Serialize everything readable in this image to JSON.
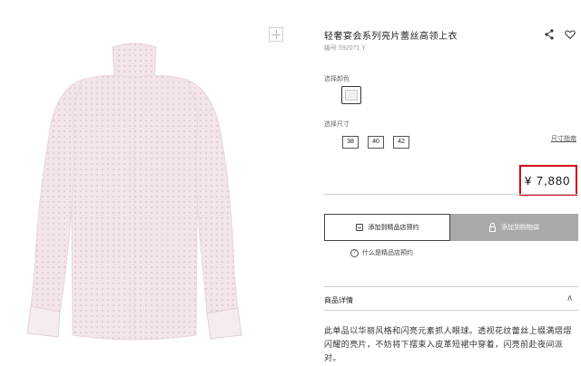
{
  "product": {
    "title": "轻奢宴会系列亮片蕾丝高领上衣",
    "sku": "编号 592071 Y",
    "image_icon": "blouse-product-image"
  },
  "icons": {
    "zoom": "plus-icon",
    "share": "share-icon",
    "favorite": "heart-icon"
  },
  "color": {
    "label": "选择颜色",
    "swatch_color": "#f2efed"
  },
  "size": {
    "label": "选择尺寸",
    "options": [
      "38",
      "40",
      "42"
    ],
    "guide": "尺寸指南"
  },
  "price": {
    "text": "¥ 7,880",
    "highlight_color": "#d0021b"
  },
  "actions": {
    "reserve": "添加到精品店预约",
    "cart": "添加到购物袋",
    "help": "什么是精品店预约"
  },
  "details": {
    "title": "商品详情",
    "toggle": "∧",
    "text": "此单品以华丽风格和闪亮元素抓人眼球。透视花纹蕾丝上缀满熠熠闪耀的亮片，不妨将下摆束入皮革短裙中穿着，闪亮前赴夜间派对。"
  }
}
